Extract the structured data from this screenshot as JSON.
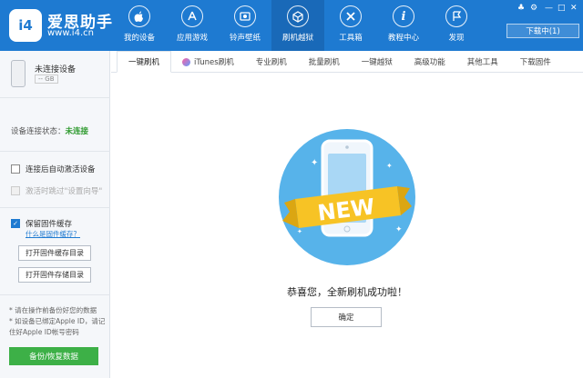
{
  "brand": {
    "logo_text": "i4",
    "name": "爱思助手",
    "url": "www.i4.cn"
  },
  "nav": [
    {
      "label": "我的设备",
      "icon": "apple-icon"
    },
    {
      "label": "应用游戏",
      "icon": "app-store-icon"
    },
    {
      "label": "铃声壁纸",
      "icon": "ringtone-wallpaper-icon"
    },
    {
      "label": "刷机越狱",
      "icon": "flash-box-icon",
      "active": true
    },
    {
      "label": "工具箱",
      "icon": "tools-icon"
    },
    {
      "label": "教程中心",
      "icon": "info-icon"
    },
    {
      "label": "发现",
      "icon": "flag-icon"
    }
  ],
  "header": {
    "download_label": "下载中(1)",
    "downloading_count": 1
  },
  "sidebar": {
    "device_name": "未连接设备",
    "device_capacity": "-- GB",
    "status_label": "设备连接状态：",
    "status_value": "未连接",
    "auto_activate": "连接后自动激活设备",
    "skip_setup": "激活时跳过\"设置向导\"",
    "keep_firmware": "保留固件缓存",
    "what_is_cache": "什么是固件缓存？",
    "open_cache_dir": "打开固件缓存目录",
    "open_storage_dir": "打开固件存储目录",
    "note1": "* 请在操作前备份好您的数据",
    "note2": "* 如设备已绑定Apple ID，请记住好Apple ID帐号密码",
    "backup_label": "备份/恢复数据"
  },
  "tabs": [
    "一键刷机",
    "iTunes刷机",
    "专业刷机",
    "批量刷机",
    "一键越狱",
    "高级功能",
    "其他工具",
    "下载固件"
  ],
  "main": {
    "badge_text": "NEW",
    "message": "恭喜您，全新刷机成功啦！",
    "ok_label": "确定"
  },
  "colors": {
    "primary": "#1e7ad1",
    "badge": "#f7c325",
    "circle": "#57b3ea",
    "success": "#3db047"
  }
}
